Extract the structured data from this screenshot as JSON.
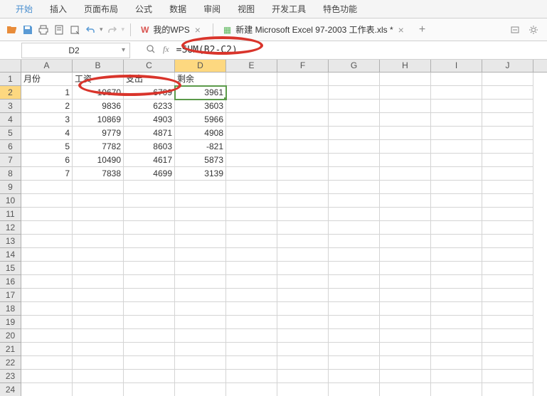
{
  "menu": {
    "items": [
      "开始",
      "插入",
      "页面布局",
      "公式",
      "数据",
      "审阅",
      "视图",
      "开发工具",
      "特色功能"
    ]
  },
  "tabs": {
    "wps": "我的WPS",
    "file": "新建 Microsoft Excel 97-2003 工作表.xls *"
  },
  "nameBox": "D2",
  "formula": "=SUM(B2-C2)",
  "fxLabel": "fx",
  "columns": [
    "A",
    "B",
    "C",
    "D",
    "E",
    "F",
    "G",
    "H",
    "I",
    "J"
  ],
  "rowCount": 24,
  "selected": {
    "row": 2,
    "col": "D"
  },
  "data": {
    "headers": [
      "月份",
      "工资",
      "支出",
      "剩余"
    ],
    "rows": [
      {
        "month": 1,
        "salary": 10670,
        "expense": 6709,
        "remain": 3961
      },
      {
        "month": 2,
        "salary": 9836,
        "expense": 6233,
        "remain": 3603
      },
      {
        "month": 3,
        "salary": 10869,
        "expense": 4903,
        "remain": 5966
      },
      {
        "month": 4,
        "salary": 9779,
        "expense": 4871,
        "remain": 4908
      },
      {
        "month": 5,
        "salary": 7782,
        "expense": 8603,
        "remain": -821
      },
      {
        "month": 6,
        "salary": 10490,
        "expense": 4617,
        "remain": 5873
      },
      {
        "month": 7,
        "salary": 7838,
        "expense": 4699,
        "remain": 3139
      }
    ]
  }
}
